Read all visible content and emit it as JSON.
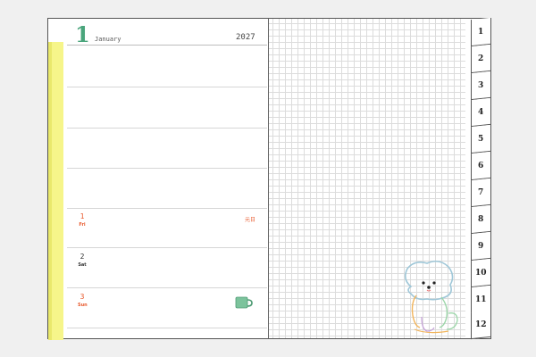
{
  "planner": {
    "month_number": "1",
    "month_name": "January",
    "year": "2027",
    "holiday_label": "元日",
    "days": [
      {
        "number": "1",
        "weekday": "Fri",
        "color": "#e8592c"
      },
      {
        "number": "2",
        "weekday": "Sat",
        "color": "#333333"
      },
      {
        "number": "3",
        "weekday": "Sun",
        "color": "#e8592c"
      }
    ],
    "month_tabs": [
      "1",
      "2",
      "3",
      "4",
      "5",
      "6",
      "7",
      "8",
      "9",
      "10",
      "11",
      "12"
    ],
    "colors": {
      "accent": "#4aa57c",
      "holiday": "#e8592c",
      "strip": "#f6f58a",
      "mug": "#7cc39c"
    },
    "icons": [
      "mug-icon",
      "dog-illustration"
    ]
  }
}
